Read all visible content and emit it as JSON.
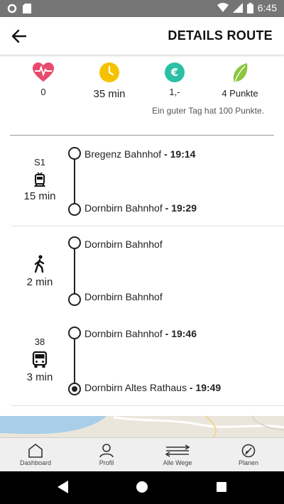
{
  "status_bar": {
    "time": "6:45"
  },
  "header": {
    "title": "DETAILS ROUTE"
  },
  "stats": [
    {
      "icon": "heart-pulse-icon",
      "value": "0",
      "color": "#e84a6e"
    },
    {
      "icon": "clock-icon",
      "value": "35 min",
      "color": "#f5c200"
    },
    {
      "icon": "euro-icon",
      "value": "1,-",
      "color": "#2bbfa5"
    },
    {
      "icon": "leaf-icon",
      "value": "4 Punkte",
      "color": "#8cc63f"
    }
  ],
  "stats_note": "Ein guter Tag hat 100 Punkte.",
  "legs": [
    {
      "mode_icon": "train-icon",
      "line": "S1",
      "duration": "15 min",
      "from": {
        "name": "Bregenz Bahnhof",
        "time": " - 19:14"
      },
      "to": {
        "name": "Dornbirn Bahnhof",
        "time": " - 19:29"
      }
    },
    {
      "mode_icon": "walking-icon",
      "line": "",
      "duration": "2 min",
      "from": {
        "name": "Dornbirn Bahnhof",
        "time": ""
      },
      "to": {
        "name": "Dornbirn Bahnhof",
        "time": ""
      }
    },
    {
      "mode_icon": "bus-icon",
      "line": "38",
      "duration": "3 min",
      "from": {
        "name": "Dornbirn Bahnhof",
        "time": " - 19:46"
      },
      "to": {
        "name": "Dornbirn Altes Rathaus",
        "time": " - 19:49"
      }
    }
  ],
  "bottom_nav": [
    {
      "icon": "home-icon",
      "label": "Dashboard"
    },
    {
      "icon": "profile-icon",
      "label": "Profil"
    },
    {
      "icon": "routes-icon",
      "label": "Alle Wege"
    },
    {
      "icon": "plan-icon",
      "label": "Planen"
    }
  ]
}
